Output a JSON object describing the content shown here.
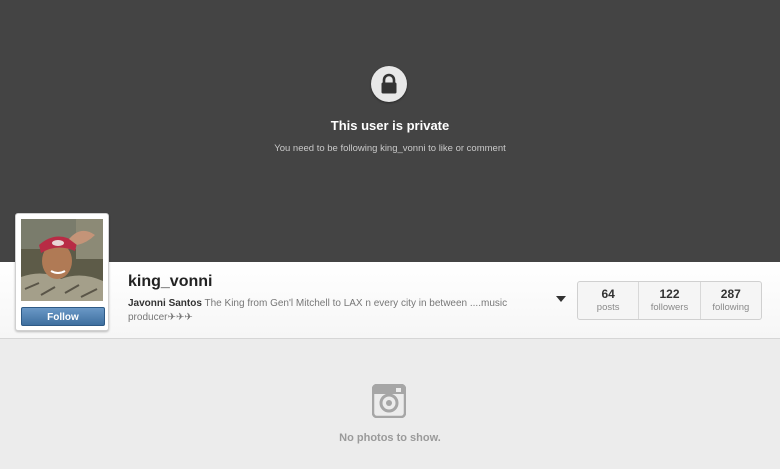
{
  "private_notice": {
    "icon": "lock-icon",
    "title": "This user is private",
    "subtitle": "You need to be following king_vonni to like or comment"
  },
  "profile": {
    "username": "king_vonni",
    "full_name": "Javonni Santos",
    "bio": "The King from Gen'l Mitchell to LAX n every city in between ....music producer✈✈✈",
    "follow_label": "Follow",
    "avatar_icon": "profile-photo",
    "options_icon": "caret-down-icon"
  },
  "stats": [
    {
      "count": "64",
      "label": "posts"
    },
    {
      "count": "122",
      "label": "followers"
    },
    {
      "count": "287",
      "label": "following"
    }
  ],
  "empty_state": {
    "icon": "camera-icon",
    "text": "No photos to show."
  },
  "colors": {
    "banner_bg": "#444444",
    "follow_button": "#4a7cad",
    "page_bg": "#ececec"
  }
}
